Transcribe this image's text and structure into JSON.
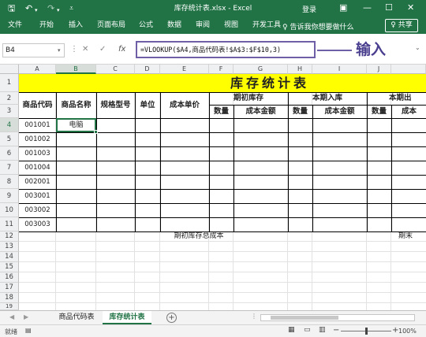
{
  "titlebar": {
    "title": "库存统计表.xlsx - Excel",
    "login": "登录",
    "icons": [
      "save-icon",
      "undo-icon",
      "redo-icon",
      "customize-icon",
      "ribbon-display-icon",
      "minimize-icon",
      "maximize-icon",
      "close-icon"
    ]
  },
  "ribbon": {
    "tabs": [
      "文件",
      "开始",
      "插入",
      "页面布局",
      "公式",
      "数据",
      "审阅",
      "视图",
      "开发工具"
    ],
    "tell_me": "♀ 告诉我你想要做什么",
    "share": "♀ 共享"
  },
  "formula_bar": {
    "name_box": "B4",
    "cancel": "✕",
    "enter": "✓",
    "fx": "fx",
    "formula": "=VLOOKUP($A4,商品代码表!$A$3:$F$10,3)",
    "annotation": "输入",
    "annotation_color": "#6f5fa6"
  },
  "columns": [
    "A",
    "B",
    "C",
    "D",
    "E",
    "F",
    "G",
    "H",
    "I",
    "J"
  ],
  "rows": [
    "1",
    "2",
    "3",
    "4",
    "5",
    "6",
    "7",
    "8",
    "9",
    "10",
    "11",
    "12",
    "13",
    "14",
    "15",
    "16",
    "17",
    "18",
    "19"
  ],
  "sheet": {
    "title": "库存统计表",
    "title_bg": "#ffff00",
    "headers": {
      "code": "商品代码",
      "name": "商品名称",
      "spec": "规格型号",
      "unit": "单位",
      "cost": "成本单价",
      "opening": "期初库存",
      "inbound": "本期入库",
      "outbound": "本期出",
      "qty": "数量",
      "amount": "成本金额",
      "cut_amount": "成本"
    },
    "codes": [
      "001001",
      "001002",
      "001003",
      "001004",
      "002001",
      "003001",
      "003002",
      "003003"
    ],
    "b4_value": "电脑",
    "total_label": "期初库存总成本",
    "total_label_cut": "期末"
  },
  "sheet_tabs": {
    "tabs": [
      "商品代码表",
      "库存统计表"
    ],
    "active": "库存统计表"
  },
  "status": {
    "ready": "就绪",
    "zoom": "100%",
    "zoom_fraction": 0.5,
    "accent": "#217346"
  }
}
